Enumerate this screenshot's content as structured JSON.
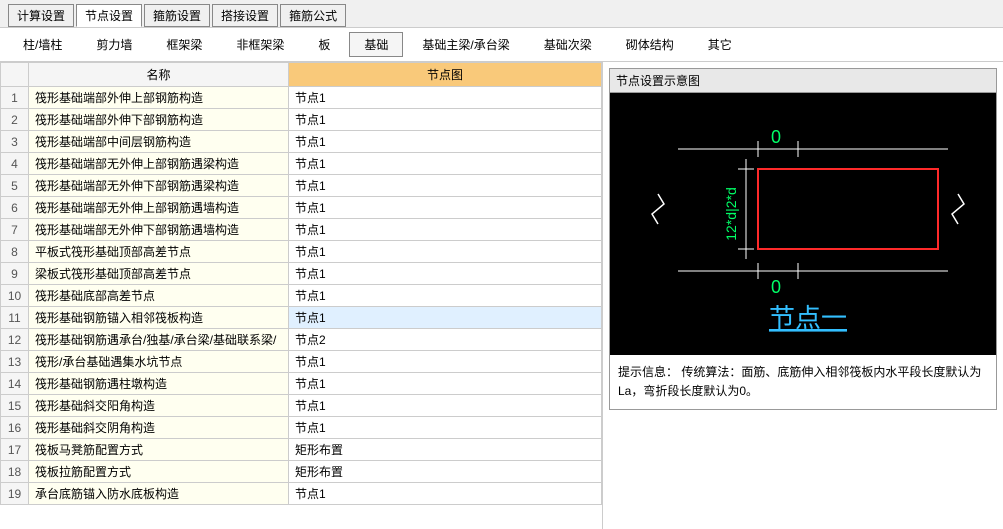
{
  "topTabs": {
    "items": [
      {
        "label": "计算设置"
      },
      {
        "label": "节点设置"
      },
      {
        "label": "箍筋设置"
      },
      {
        "label": "搭接设置"
      },
      {
        "label": "箍筋公式"
      }
    ],
    "activeIndex": 1
  },
  "subTabs": {
    "items": [
      {
        "label": "柱/墙柱"
      },
      {
        "label": "剪力墙"
      },
      {
        "label": "框架梁"
      },
      {
        "label": "非框架梁"
      },
      {
        "label": "板"
      },
      {
        "label": "基础"
      },
      {
        "label": "基础主梁/承台梁"
      },
      {
        "label": "基础次梁"
      },
      {
        "label": "砌体结构"
      },
      {
        "label": "其它"
      }
    ],
    "activeIndex": 5
  },
  "table": {
    "headers": {
      "name": "名称",
      "node": "节点图"
    },
    "rows": [
      {
        "num": "1",
        "name": "筏形基础端部外伸上部钢筋构造",
        "node": "节点1"
      },
      {
        "num": "2",
        "name": "筏形基础端部外伸下部钢筋构造",
        "node": "节点1"
      },
      {
        "num": "3",
        "name": "筏形基础端部中间层钢筋构造",
        "node": "节点1"
      },
      {
        "num": "4",
        "name": "筏形基础端部无外伸上部钢筋遇梁构造",
        "node": "节点1"
      },
      {
        "num": "5",
        "name": "筏形基础端部无外伸下部钢筋遇梁构造",
        "node": "节点1"
      },
      {
        "num": "6",
        "name": "筏形基础端部无外伸上部钢筋遇墙构造",
        "node": "节点1"
      },
      {
        "num": "7",
        "name": "筏形基础端部无外伸下部钢筋遇墙构造",
        "node": "节点1"
      },
      {
        "num": "8",
        "name": "平板式筏形基础顶部高差节点",
        "node": "节点1"
      },
      {
        "num": "9",
        "name": "梁板式筏形基础顶部高差节点",
        "node": "节点1"
      },
      {
        "num": "10",
        "name": "筏形基础底部高差节点",
        "node": "节点1"
      },
      {
        "num": "11",
        "name": "筏形基础钢筋锚入相邻筏板构造",
        "node": "节点1",
        "selected": true
      },
      {
        "num": "12",
        "name": "筏形基础钢筋遇承台/独基/承台梁/基础联系梁/",
        "node": "节点2"
      },
      {
        "num": "13",
        "name": "筏形/承台基础遇集水坑节点",
        "node": "节点1"
      },
      {
        "num": "14",
        "name": "筏形基础钢筋遇柱墩构造",
        "node": "节点1"
      },
      {
        "num": "15",
        "name": "筏形基础斜交阳角构造",
        "node": "节点1"
      },
      {
        "num": "16",
        "name": "筏形基础斜交阴角构造",
        "node": "节点1"
      },
      {
        "num": "17",
        "name": "筏板马凳筋配置方式",
        "node": "矩形布置"
      },
      {
        "num": "18",
        "name": "筏板拉筋配置方式",
        "node": "矩形布置"
      },
      {
        "num": "19",
        "name": "承台底筋锚入防水底板构造",
        "node": "节点1"
      }
    ]
  },
  "diagram": {
    "title": "节点设置示意图",
    "labels": {
      "top": "0",
      "bottom": "0",
      "vert": "12*d|2*d",
      "caption": "节点一"
    },
    "hintLabel": "提示信息：",
    "hintText": "传统算法：面筋、底筋伸入相邻筏板内水平段长度默认为La，弯折段长度默认为0。"
  }
}
